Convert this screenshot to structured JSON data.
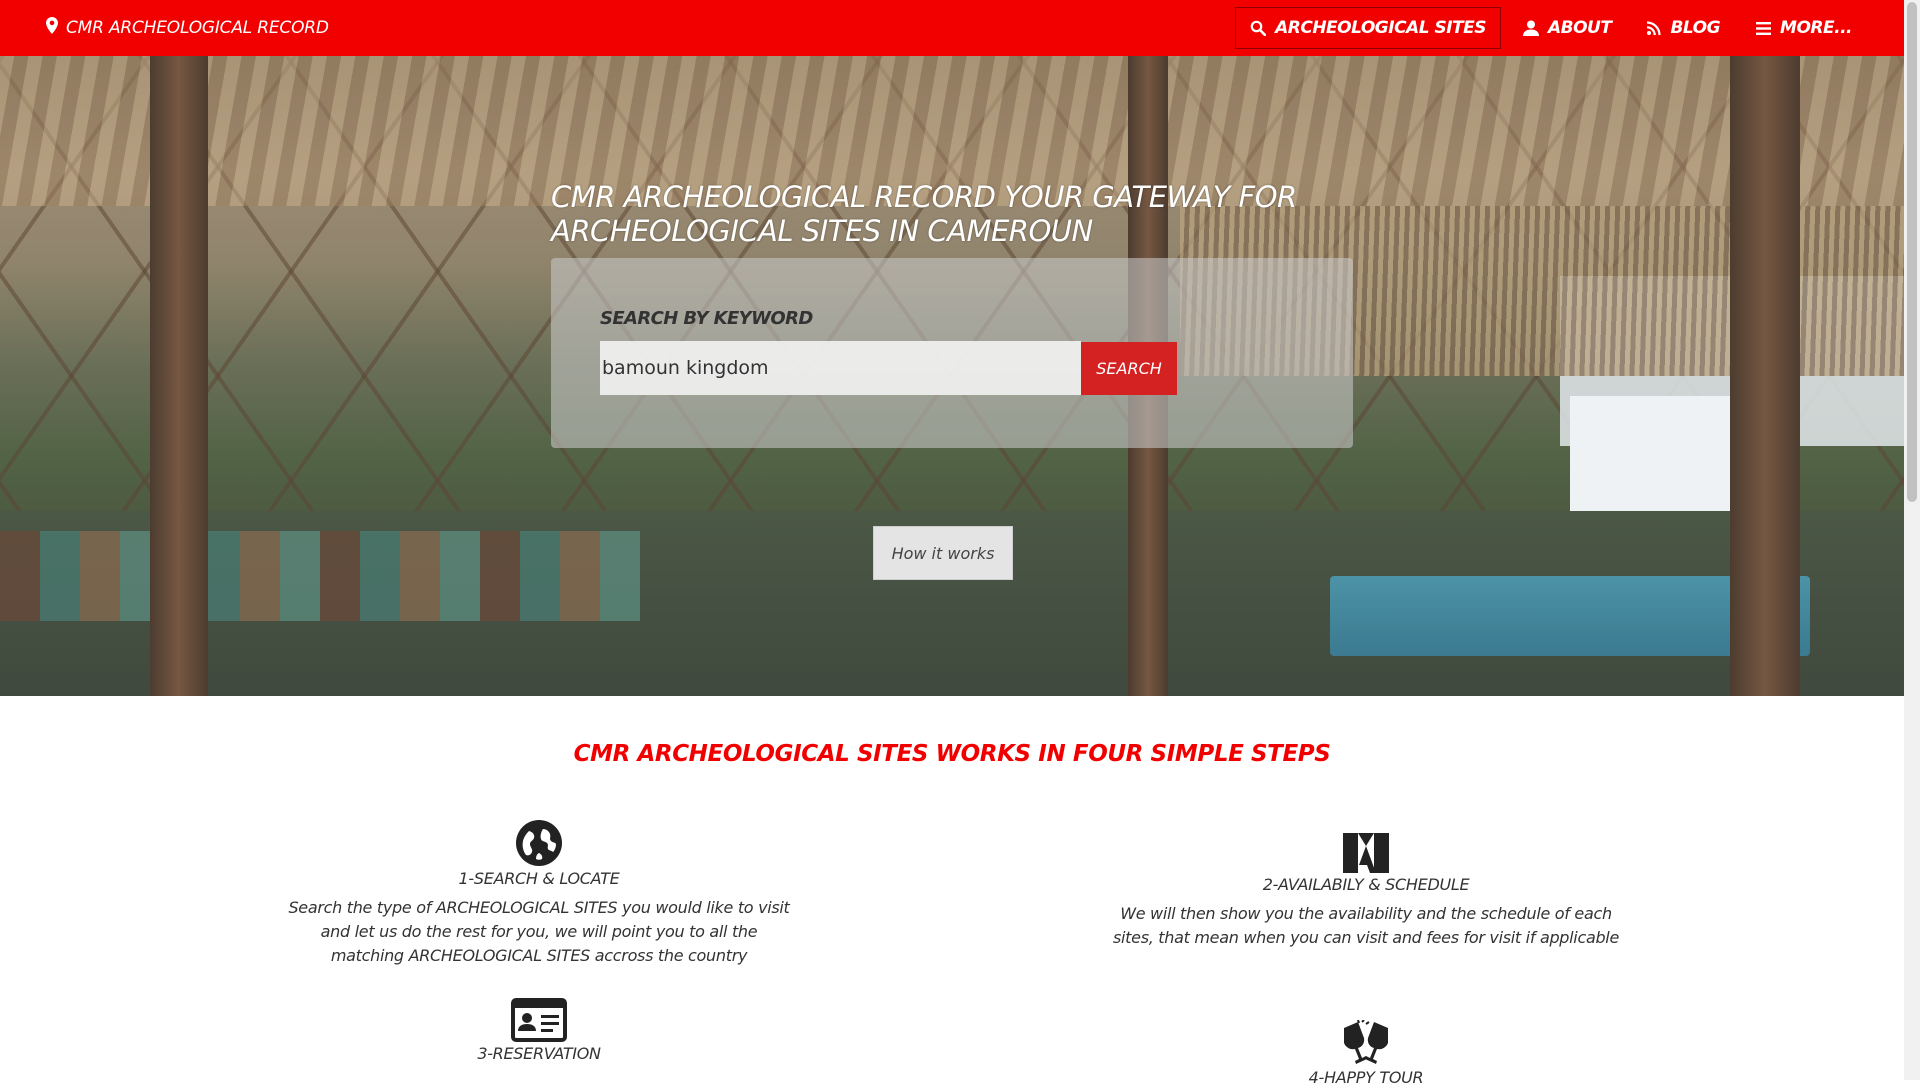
{
  "navbar": {
    "brand_label": "CMR ARCHEOLOGICAL RECORD",
    "items": [
      {
        "label": "ARCHEOLOGICAL SITES",
        "icon": "search-icon",
        "active": true
      },
      {
        "label": "ABOUT",
        "icon": "user-icon",
        "active": false
      },
      {
        "label": "BLOG",
        "icon": "rss-icon",
        "active": false
      },
      {
        "label": "MORE...",
        "icon": "menu-icon",
        "active": false
      }
    ]
  },
  "hero": {
    "title": "CMR ARCHEOLOGICAL RECORD YOUR GATEWAY FOR ARCHEOLOGICAL SITES IN CAMEROUN",
    "search": {
      "label": "SEARCH BY KEYWORD",
      "value": "bamoun kingdom",
      "button_label": "SEARCH"
    },
    "how_button_label": "How it works"
  },
  "steps": {
    "title": "CMR ARCHEOLOGICAL SITES WORKS IN FOUR SIMPLE STEPS",
    "items": [
      {
        "icon": "globe-icon",
        "title": "1-SEARCH & LOCATE",
        "description": "Search the type of ARCHEOLOGICAL SITES you would like to visit and let us do the rest for you, we will point you to all the matching ARCHEOLOGICAL SITES accross the country"
      },
      {
        "icon": "adobe-icon",
        "title": "2-AVAILABILY & SCHEDULE",
        "description": "We will then show you the availability and the schedule of each sites, that mean when you can visit and fees for visit if applicable"
      },
      {
        "icon": "id-card-icon",
        "title": "3-RESERVATION",
        "description": ""
      },
      {
        "icon": "glasses-cheers-icon",
        "title": "4-HAPPY TOUR",
        "description": ""
      }
    ]
  },
  "colors": {
    "navbar_bg": "#f20000",
    "accent_red": "#f20000",
    "search_button_bg": "#d42121"
  }
}
